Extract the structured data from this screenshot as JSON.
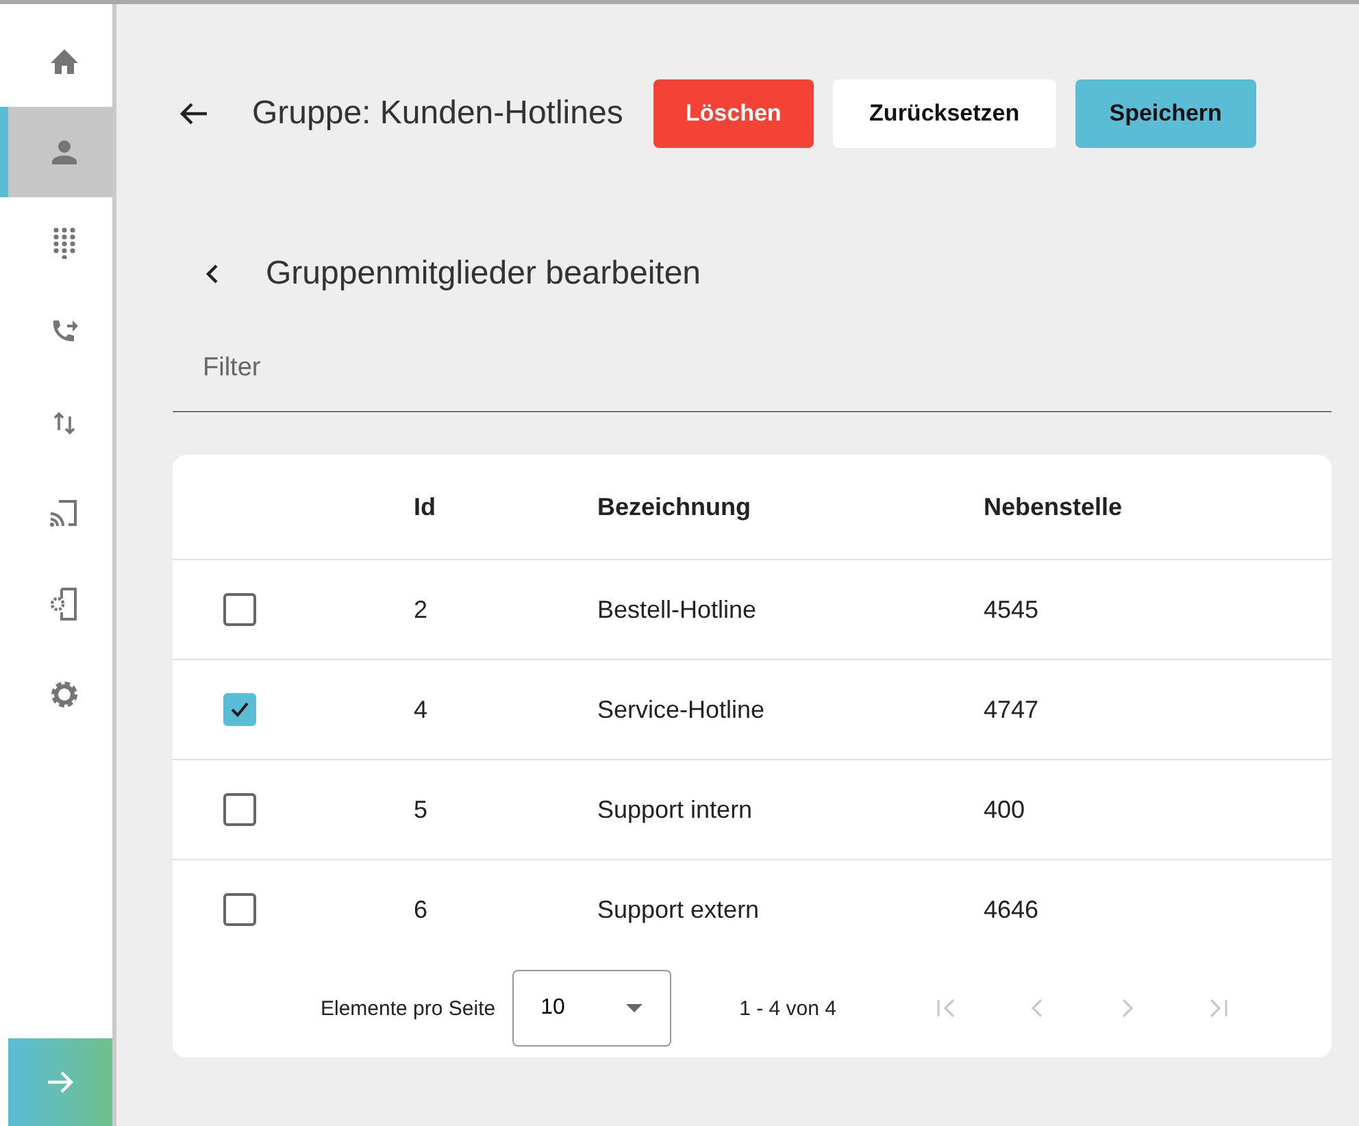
{
  "sidebar": {
    "items": [
      {
        "selected": false
      },
      {
        "selected": true
      },
      {
        "selected": false
      },
      {
        "selected": false
      },
      {
        "selected": false
      },
      {
        "selected": false
      },
      {
        "selected": false
      },
      {
        "selected": false
      }
    ]
  },
  "header": {
    "title": "Gruppe: Kunden-Hotlines",
    "buttons": [
      {
        "label": "Löschen",
        "kind": "danger"
      },
      {
        "label": "Zurücksetzen",
        "kind": "plain"
      },
      {
        "label": "Speichern",
        "kind": "primary"
      }
    ]
  },
  "section": {
    "title": "Gruppenmitglieder bearbeiten"
  },
  "filter": {
    "placeholder": "Filter"
  },
  "table": {
    "columns": [
      "Id",
      "Bezeichnung",
      "Nebenstelle"
    ],
    "rows": [
      {
        "checked": false,
        "cells": [
          "2",
          "Bestell-Hotline",
          "4545"
        ]
      },
      {
        "checked": true,
        "cells": [
          "4",
          "Service-Hotline",
          "4747"
        ]
      },
      {
        "checked": false,
        "cells": [
          "5",
          "Support intern",
          "400"
        ]
      },
      {
        "checked": false,
        "cells": [
          "6",
          "Support extern",
          "4646"
        ]
      }
    ]
  },
  "pagination": {
    "label": "Elemente pro Seite",
    "page_size": "10",
    "range": "1 - 4 von 4"
  }
}
